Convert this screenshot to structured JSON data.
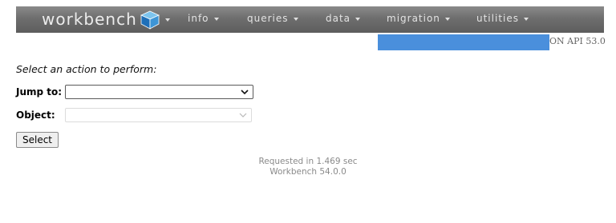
{
  "app": {
    "logo_text": "workbench",
    "logo_icon": "cube-icon"
  },
  "nav": {
    "items": [
      {
        "label": "info",
        "icon": "caret-down-icon"
      },
      {
        "label": "queries",
        "icon": "caret-down-icon"
      },
      {
        "label": "data",
        "icon": "caret-down-icon"
      },
      {
        "label": "migration",
        "icon": "caret-down-icon"
      },
      {
        "label": "utilities",
        "icon": "caret-down-icon"
      }
    ]
  },
  "status": {
    "api_text": "ON API 53.0",
    "redacted_bar_color": "#4a8fdc"
  },
  "form": {
    "prompt": "Select an action to perform:",
    "jump_label": "Jump to:",
    "jump_value": "",
    "object_label": "Object:",
    "object_value": "",
    "submit_label": "Select"
  },
  "footer": {
    "requested": "Requested in 1.469 sec",
    "version": "Workbench 54.0.0"
  },
  "colors": {
    "navbar": "#6e6e6e",
    "nav_text": "#e4e4e4",
    "footer_text": "#8a8a8a"
  }
}
